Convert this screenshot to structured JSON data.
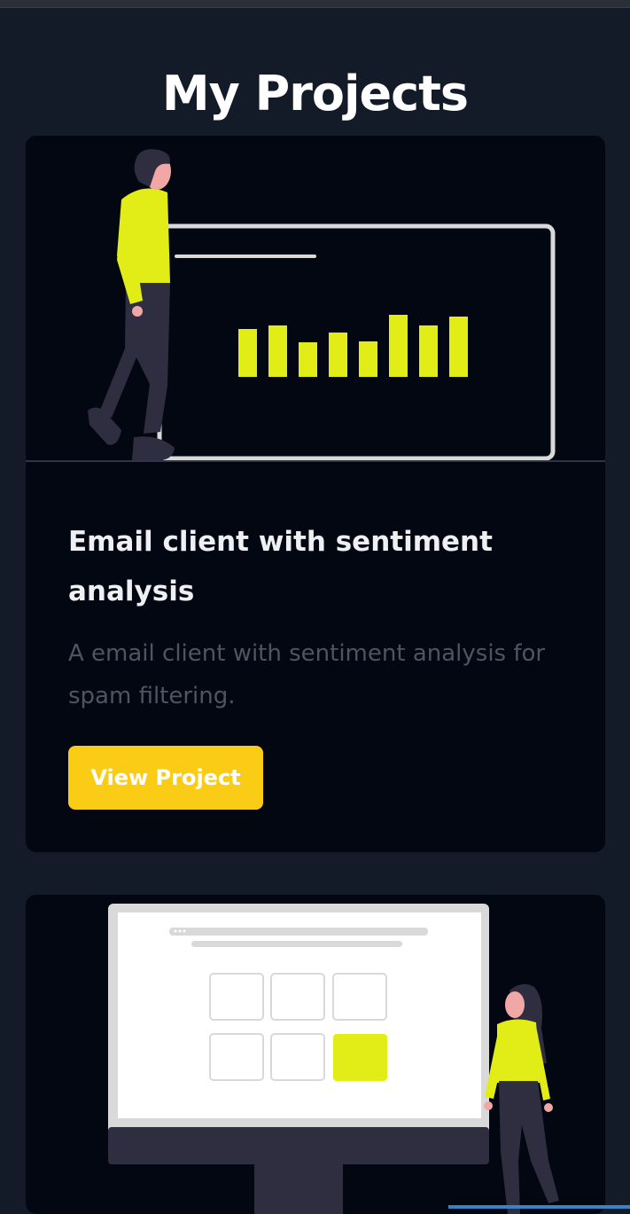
{
  "page": {
    "title": "My Projects"
  },
  "projects": [
    {
      "title": "Email client with sentiment analysis",
      "description": "A email client with sentiment analysis for spam filtering.",
      "button_label": "View Project",
      "illustration": "man-presenting-bar-chart-illustration"
    },
    {
      "illustration": "woman-beside-monitor-grid-illustration"
    }
  ],
  "colors": {
    "background": "#131a28",
    "card": "#030711",
    "accent": "#facc15",
    "illustration_accent": "#e2ec17",
    "title_text": "#ffffff",
    "muted_text": "#4d5563"
  }
}
